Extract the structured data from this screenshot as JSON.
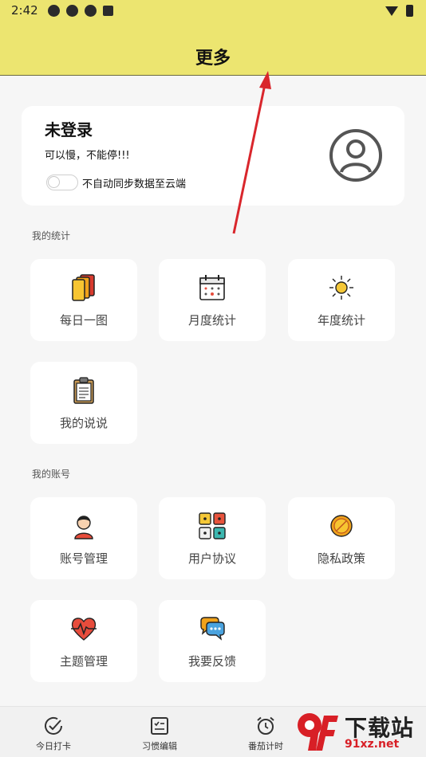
{
  "status": {
    "time": "2:42"
  },
  "header": {
    "title": "更多"
  },
  "login": {
    "name": "未登录",
    "motto": "可以慢，不能停!!!",
    "sync_label": "不自动同步数据至云端",
    "sync_on": false
  },
  "stats": {
    "section_title": "我的统计",
    "items": [
      {
        "label": "每日一图",
        "icon": "cards-icon"
      },
      {
        "label": "月度统计",
        "icon": "calendar-icon"
      },
      {
        "label": "年度统计",
        "icon": "sun-icon"
      },
      {
        "label": "我的说说",
        "icon": "clipboard-icon"
      }
    ]
  },
  "account": {
    "section_title": "我的账号",
    "items": [
      {
        "label": "账号管理",
        "icon": "user-icon"
      },
      {
        "label": "用户协议",
        "icon": "grid-icon"
      },
      {
        "label": "隐私政策",
        "icon": "coin-icon"
      },
      {
        "label": "主题管理",
        "icon": "heart-pulse-icon"
      },
      {
        "label": "我要反馈",
        "icon": "chat-icon"
      }
    ]
  },
  "tabs": [
    {
      "label": "今日打卡",
      "icon": "check-circle-icon"
    },
    {
      "label": "习惯编辑",
      "icon": "checklist-icon"
    },
    {
      "label": "番茄计时",
      "icon": "alarm-icon"
    }
  ],
  "watermark": {
    "brand": "下载站",
    "domain": "91xz.net",
    "logo": "9f"
  },
  "colors": {
    "header_bg": "#ece570",
    "card_bg": "#ffffff",
    "page_bg": "#f6f6f6",
    "arrow": "#d9262c"
  }
}
